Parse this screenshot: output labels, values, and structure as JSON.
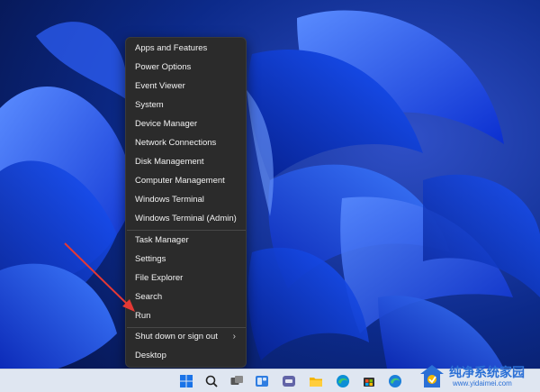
{
  "context_menu": {
    "items": [
      {
        "label": "Apps and Features"
      },
      {
        "label": "Power Options"
      },
      {
        "label": "Event Viewer"
      },
      {
        "label": "System"
      },
      {
        "label": "Device Manager"
      },
      {
        "label": "Network Connections"
      },
      {
        "label": "Disk Management"
      },
      {
        "label": "Computer Management"
      },
      {
        "label": "Windows Terminal"
      },
      {
        "label": "Windows Terminal (Admin)"
      },
      {
        "label": "Task Manager"
      },
      {
        "label": "Settings"
      },
      {
        "label": "File Explorer"
      },
      {
        "label": "Search"
      },
      {
        "label": "Run"
      },
      {
        "label": "Shut down or sign out",
        "submenu_icon": "chevron-right-icon"
      },
      {
        "label": "Desktop"
      }
    ]
  },
  "annotation": {
    "color": "#e53935",
    "points_to": "Run"
  },
  "taskbar": {
    "icons": [
      "windows-start-icon",
      "search-icon",
      "task-view-icon",
      "widgets-icon",
      "teams-chat-icon",
      "file-explorer-icon",
      "edge-icon",
      "microsoft-store-icon",
      "edge-browser-icon"
    ]
  },
  "watermark": {
    "title": "纯净系统家园",
    "url": "www.yidaimei.com"
  },
  "colors": {
    "menu_bg": "#2b2b2b",
    "menu_text": "#f2f2f2",
    "wallpaper_blue": "#1e4fff",
    "taskbar_bg": "#dfe6f1"
  }
}
